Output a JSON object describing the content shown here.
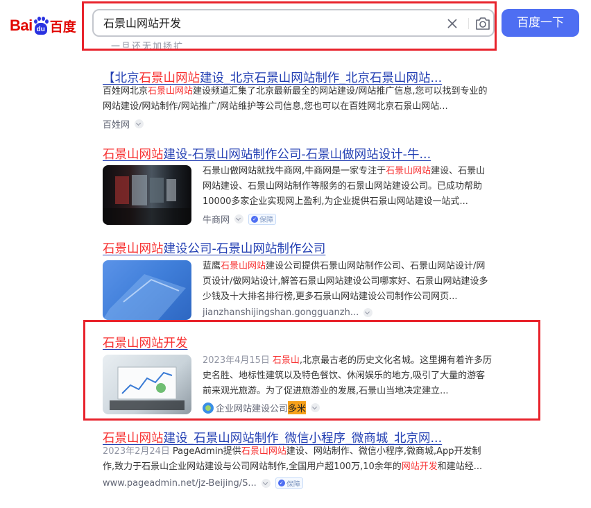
{
  "header": {
    "logo_left": "Bai",
    "logo_paw": "du",
    "logo_right": "百度",
    "query": "石景山网站开发",
    "search_button": "百度一下",
    "clear_icon": "close-icon",
    "camera_icon": "camera-icon",
    "ghost_text": "一旦还无加扬扩"
  },
  "results": [
    {
      "title_parts": [
        "【北京",
        "石景山网站",
        "建设_北京石景山网站制作_北京石景山网站..."
      ],
      "desc_parts": [
        "百姓网北京",
        "石景山网站",
        "建设频道汇集了北京最新最全的网站建设/网站推广信息,您可以找到专业的网站建设/网站制作/网站推广/网站维护等公司信息,您也可以在百姓网北京石景山网站..."
      ],
      "source": "百姓网"
    },
    {
      "title_parts": [
        "石景山网站",
        "建设-石景山网站制作公司-石景山做网站设计-牛..."
      ],
      "desc_parts": [
        "石景山做网站就找牛商网,牛商网是一家专注于",
        "石景山网站",
        "建设、石景山网站建设、石景山网站制作等服务的石景山网站建设公司。已成功帮助10000多家企业实现网上盈利,为企业提供石景山网站建设一站式..."
      ],
      "source": "牛商网",
      "badge": "保障"
    },
    {
      "title_parts": [
        "石景山网站",
        "建设公司-石景山网站制作公司"
      ],
      "desc_parts": [
        "蓝鹰",
        "石景山网站",
        "建设公司提供石景山网站制作公司、石景山网站设计/网页设计/做网站设计,解答石景山网站建设公司哪家好、石景山网站建设多少钱及十大排名排行榜,更多石景山网站建设公司制作公司网页..."
      ],
      "source": "jianzhanshijingshan.gongguanzh..."
    },
    {
      "title_parts": [
        "石景山网站开发"
      ],
      "date": "2023年4月15日",
      "desc_parts": [
        "石景山",
        ",北京最古老的历史文化名城。这里拥有着许多历史名胜、地标性建筑以及特色餐饮、休闲娱乐的地方,吸引了大量的游客前来观光旅游。为了促进旅游业的发展,石景山当地决定建立..."
      ],
      "source": "企业网站建设公司",
      "source_highlight": "多米"
    },
    {
      "title_parts": [
        "石景山网站",
        "建设_石景山网站制作_微信小程序_微商城_北京网..."
      ],
      "date": "2023年2月24日",
      "desc_parts": [
        "PageAdmin提供",
        "石景山网站",
        "建设、网站制作、微信小程序,微商城,App开发制作,致力于石景山企业网站建设与公司网站制作,全国用户超100万,10余年的",
        "网站开发",
        "和建站经..."
      ],
      "source": "www.pageadmin.net/jz-Beijing/S...",
      "badge": "保障"
    }
  ],
  "colors": {
    "link": "#2440b3",
    "highlight": "#f73131",
    "button": "#4e6ef2",
    "annotation": "#e8232c"
  }
}
